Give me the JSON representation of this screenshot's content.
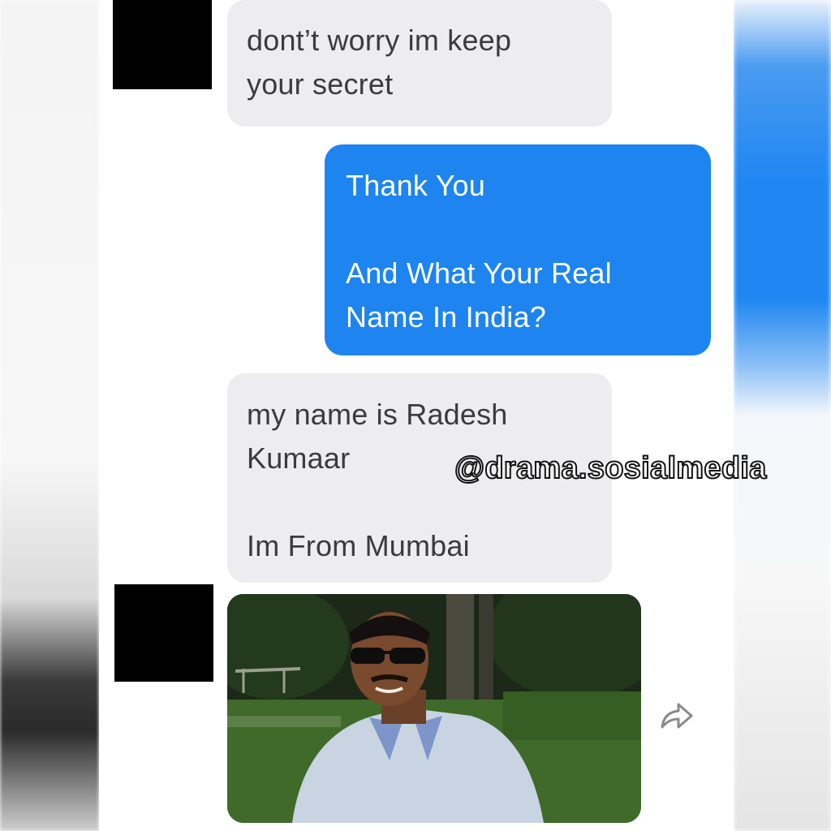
{
  "messages": [
    {
      "id": "m1",
      "direction": "incoming",
      "lines": [
        "dont’t worry im keep",
        "your secret"
      ]
    },
    {
      "id": "m2",
      "direction": "outgoing",
      "lines": [
        "Thank You",
        "",
        "And What Your Real",
        "Name In India?"
      ]
    },
    {
      "id": "m3",
      "direction": "incoming",
      "lines": [
        "my name is Radesh",
        "Kumaar",
        "",
        "Im From Mumbai"
      ]
    },
    {
      "id": "m4",
      "direction": "incoming",
      "type": "photo",
      "description_icon": "share-icon"
    }
  ],
  "watermark": "@drama.sosialmedia",
  "colors": {
    "incoming_bubble": "#ededf0",
    "outgoing_bubble": "#1d84f0",
    "incoming_text": "#3b3b3b",
    "outgoing_text": "#ffffff",
    "avatar_redaction": "#000000"
  }
}
